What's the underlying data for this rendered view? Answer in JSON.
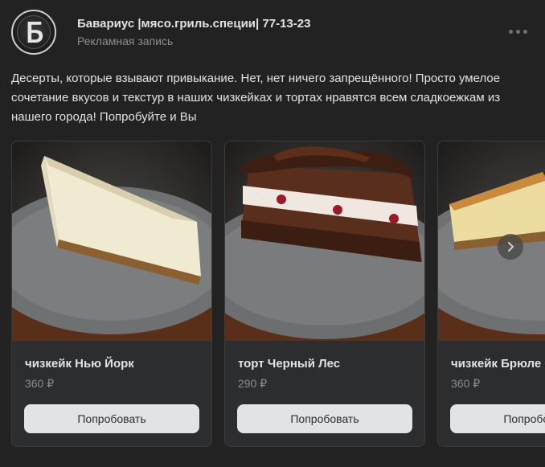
{
  "post": {
    "author": "Бавариус |мясо.гриль.специи| 77-13-23",
    "subtitle": "Рекламная запись",
    "text": "Десерты, которые взывают привыкание. Нет, нет ничего запрещённого! Просто умелое сочетание вкусов и текстур в наших чизкейках и тортах нравятся всем сладкоежкам из нашего города! Попробуйте и Вы",
    "avatar_icon": "bavarius-logo-icon",
    "more_icon": "more-dots-icon"
  },
  "products": [
    {
      "title": "чизкейк Нью Йорк",
      "price": "360 ₽",
      "button": "Попробовать"
    },
    {
      "title": "торт Черный Лес",
      "price": "290 ₽",
      "button": "Попробовать"
    },
    {
      "title": "чизкейк Брюле",
      "price": "360 ₽",
      "button": "Попробовать"
    }
  ],
  "carousel": {
    "next_icon": "chevron-right-icon"
  },
  "colors": {
    "background": "#222222",
    "card": "#2c2d2e",
    "text": "#e1e3e6",
    "secondary_text": "#8a8d91",
    "button_bg": "#e1e3e6"
  }
}
